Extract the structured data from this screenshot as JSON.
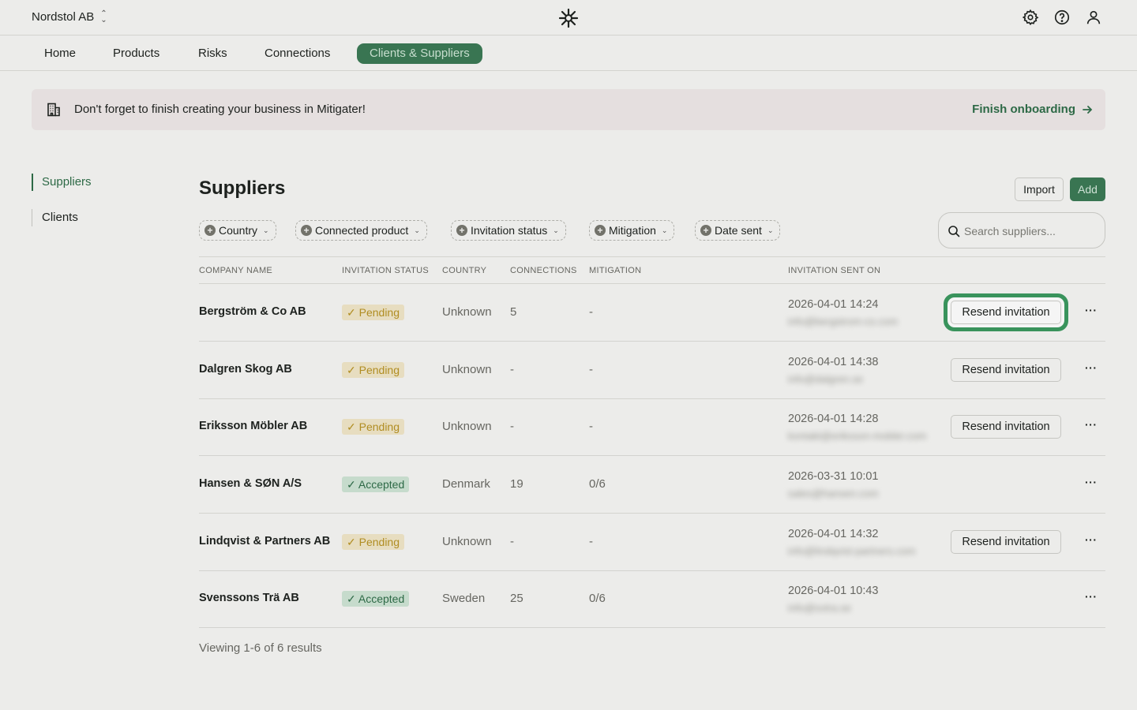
{
  "header": {
    "org_name": "Nordstol AB",
    "icons": [
      "settings-icon",
      "help-icon",
      "user-icon"
    ]
  },
  "nav": {
    "tabs": [
      {
        "label": "Home"
      },
      {
        "label": "Products"
      },
      {
        "label": "Risks"
      },
      {
        "label": "Connections"
      },
      {
        "label": "Clients & Suppliers",
        "active": true
      }
    ]
  },
  "banner": {
    "text": "Don't forget to finish creating your business in Mitigater!",
    "link_label": "Finish onboarding"
  },
  "sidebar": {
    "items": [
      {
        "label": "Suppliers",
        "active": true
      },
      {
        "label": "Clients"
      }
    ]
  },
  "page": {
    "title": "Suppliers",
    "import_label": "Import",
    "add_label": "Add"
  },
  "filters": [
    {
      "label": "Country"
    },
    {
      "label": "Connected product"
    },
    {
      "label": "Invitation status"
    },
    {
      "label": "Mitigation"
    },
    {
      "label": "Date sent"
    }
  ],
  "search": {
    "placeholder": "Search suppliers..."
  },
  "table": {
    "columns": [
      "COMPANY NAME",
      "INVITATION STATUS",
      "COUNTRY",
      "CONNECTIONS",
      "MITIGATION",
      "INVITATION SENT ON"
    ],
    "resend_label": "Resend invitation",
    "rows": [
      {
        "company": "Bergström & Co AB",
        "status": "Pending",
        "country": "Unknown",
        "connections": "5",
        "mitigation": "-",
        "sent_on": "2026-04-01 14:24",
        "email": "info@bergstrom-co.com",
        "resend": true,
        "highlight": true
      },
      {
        "company": "Dalgren Skog AB",
        "status": "Pending",
        "country": "Unknown",
        "connections": "-",
        "mitigation": "-",
        "sent_on": "2026-04-01 14:38",
        "email": "info@dalgren.se",
        "resend": true
      },
      {
        "company": "Eriksson Möbler AB",
        "status": "Pending",
        "country": "Unknown",
        "connections": "-",
        "mitigation": "-",
        "sent_on": "2026-04-01 14:28",
        "email": "kontakt@eriksson-mobler.com",
        "resend": true
      },
      {
        "company": "Hansen & SØN A/S",
        "status": "Accepted",
        "country": "Denmark",
        "connections": "19",
        "mitigation": "0/6",
        "sent_on": "2026-03-31 10:01",
        "email": "sales@hansen.com",
        "resend": false
      },
      {
        "company": "Lindqvist & Partners AB",
        "status": "Pending",
        "country": "Unknown",
        "connections": "-",
        "mitigation": "-",
        "sent_on": "2026-04-01 14:32",
        "email": "info@lindqvist-partners.com",
        "resend": true
      },
      {
        "company": "Svenssons Trä AB",
        "status": "Accepted",
        "country": "Sweden",
        "connections": "25",
        "mitigation": "0/6",
        "sent_on": "2026-04-01 10:43",
        "email": "info@svtra.se",
        "resend": false
      }
    ]
  },
  "footer": {
    "results_text": "Viewing 1-6 of 6 results"
  }
}
